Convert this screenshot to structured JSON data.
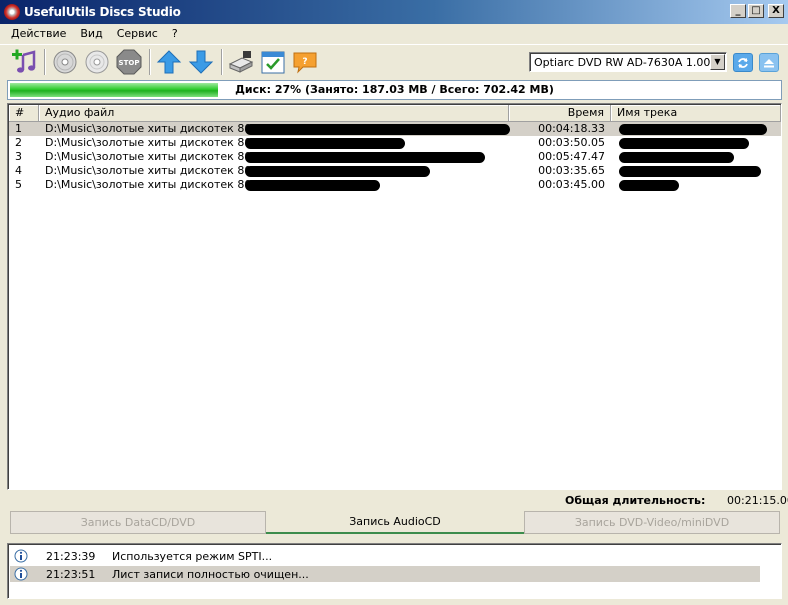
{
  "window": {
    "title": "UsefulUtils Discs Studio",
    "minimize": "_",
    "maximize": "□",
    "close": "X"
  },
  "menu": [
    "Действие",
    "Вид",
    "Сервис",
    "?"
  ],
  "toolbar": {
    "icons": [
      "add-music-icon",
      "disc-icon",
      "disc-erase-icon",
      "stop-icon",
      "move-up-icon",
      "move-down-icon",
      "drive-icon",
      "calendar-icon",
      "chat-icon"
    ],
    "drive": "Optiarc DVD RW AD-7630A 1.00",
    "refresh_icon": "refresh-icon",
    "eject_icon": "eject-icon"
  },
  "disk": {
    "text": "Диск: 27% (Занято: 187.03 MB / Всего: 702.42 MB)",
    "percent": 27
  },
  "list": {
    "columns": [
      "#",
      "Аудио файл",
      "Время",
      "Имя трека"
    ],
    "rows": [
      {
        "num": "1",
        "file": "D:\\Music\\золотые хиты дискотек 80-х\\",
        "time": "00:04:18.33"
      },
      {
        "num": "2",
        "file": "D:\\Music\\золотые хиты дискотек 80-х\\",
        "time": "00:03:50.05"
      },
      {
        "num": "3",
        "file": "D:\\Music\\золотые хиты дискотек 80-х\\",
        "time": "00:05:47.47"
      },
      {
        "num": "4",
        "file": "D:\\Music\\золотые хиты дискотек 80-х\\",
        "time": "00:03:35.65"
      },
      {
        "num": "5",
        "file": "D:\\Music\\золотые хиты дискотек 80-х\\",
        "time": "00:03:45.00"
      }
    ]
  },
  "total": {
    "label": "Общая длительность:",
    "value": "00:21:15.00"
  },
  "tabs": [
    {
      "label": "Запись DataCD/DVD",
      "active": false
    },
    {
      "label": "Запись AudioCD",
      "active": true
    },
    {
      "label": "Запись DVD-Video/miniDVD",
      "active": false
    }
  ],
  "log": [
    {
      "time": "21:23:39",
      "message": "Используется режим SPTI..."
    },
    {
      "time": "21:23:51",
      "message": "Лист записи полностью очищен..."
    }
  ],
  "colors": {
    "progress": "#2ecc2e",
    "titlebar": "#0a246a"
  }
}
